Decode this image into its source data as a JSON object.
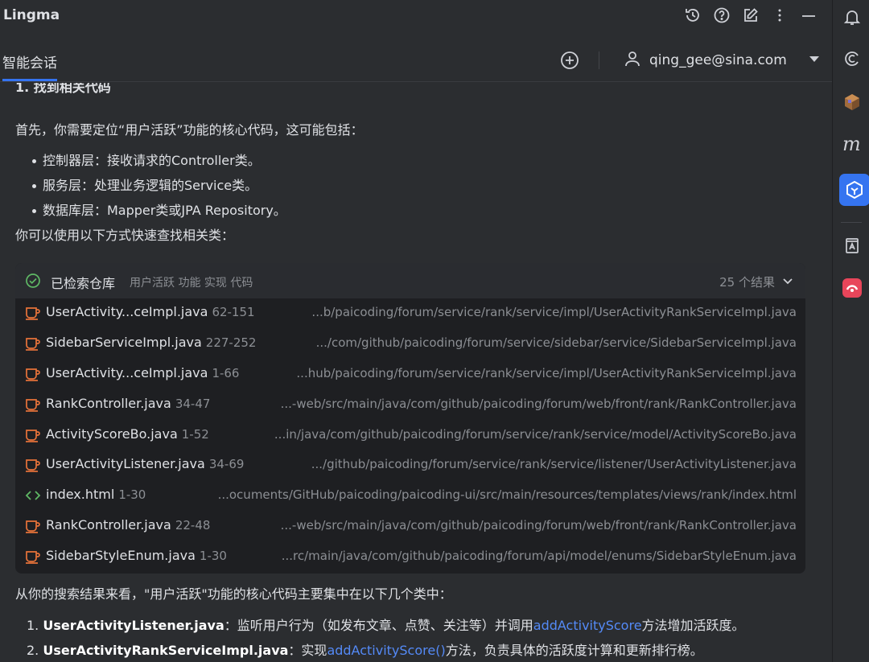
{
  "app": {
    "title": "Lingma"
  },
  "tabs": {
    "active_label": "智能会话"
  },
  "user": {
    "email": "qing_gee@sina.com"
  },
  "content": {
    "cut_heading": "1. 找到相关代码",
    "intro": "首先，你需要定位“用户活跃”功能的核心代码，这可能包括：",
    "bullets": [
      "控制器层：接收请求的Controller类。",
      "服务层：处理业务逻辑的Service类。",
      "数据库层：Mapper类或JPA Repository。"
    ],
    "find_hint": "你可以使用以下方式快速查找相关类：",
    "conclusion": "从你的搜索结果来看，\"用户活跃\"功能的核心代码主要集中在以下几个类中：",
    "list": [
      {
        "num": "1.",
        "name": "UserActivityListener.java",
        "pre": "：监听用户行为（如发布文章、点赞、关注等）并调用",
        "link": "addActivityScore",
        "post": "方法增加活跃度。"
      },
      {
        "num": "2.",
        "name": "UserActivityRankServiceImpl.java",
        "pre": "：实现",
        "link": "addActivityScore()",
        "post": "方法，负责具体的活跃度计算和更新排行榜。"
      }
    ]
  },
  "search": {
    "title": "已检索仓库",
    "query": "用户活跃 功能 实现 代码",
    "count": "25 个结果",
    "results": [
      {
        "icon": "java-cup-icon",
        "name": "UserActivity...ceImpl.java",
        "range": "62-151",
        "path": "...b/paicoding/forum/service/rank/service/impl/UserActivityRankServiceImpl.java"
      },
      {
        "icon": "java-cup-icon",
        "name": "SidebarServiceImpl.java",
        "range": "227-252",
        "path": ".../com/github/paicoding/forum/service/sidebar/service/SidebarServiceImpl.java"
      },
      {
        "icon": "java-cup-icon",
        "name": "UserActivity...ceImpl.java",
        "range": "1-66",
        "path": "...hub/paicoding/forum/service/rank/service/impl/UserActivityRankServiceImpl.java"
      },
      {
        "icon": "java-cup-icon",
        "name": "RankController.java",
        "range": "34-47",
        "path": "...-web/src/main/java/com/github/paicoding/forum/web/front/rank/RankController.java"
      },
      {
        "icon": "java-cup-icon",
        "name": "ActivityScoreBo.java",
        "range": "1-52",
        "path": "...in/java/com/github/paicoding/forum/service/rank/service/model/ActivityScoreBo.java"
      },
      {
        "icon": "java-cup-icon",
        "name": "UserActivityListener.java",
        "range": "34-69",
        "path": ".../github/paicoding/forum/service/rank/service/listener/UserActivityListener.java"
      },
      {
        "icon": "html-code-icon",
        "name": "index.html",
        "range": "1-30",
        "path": "...ocuments/GitHub/paicoding/paicoding-ui/src/main/resources/templates/views/rank/index.html"
      },
      {
        "icon": "java-cup-icon",
        "name": "RankController.java",
        "range": "22-48",
        "path": "...-web/src/main/java/com/github/paicoding/forum/web/front/rank/RankController.java"
      },
      {
        "icon": "java-cup-icon",
        "name": "SidebarStyleEnum.java",
        "range": "1-30",
        "path": "...rc/main/java/com/github/paicoding/forum/api/model/enums/SidebarStyleEnum.java"
      }
    ]
  },
  "colors": {
    "accent": "#3574f0",
    "link": "#548af7",
    "java_icon": "#e8733a",
    "html_icon": "#5fb865",
    "ok_icon": "#5fb865"
  }
}
